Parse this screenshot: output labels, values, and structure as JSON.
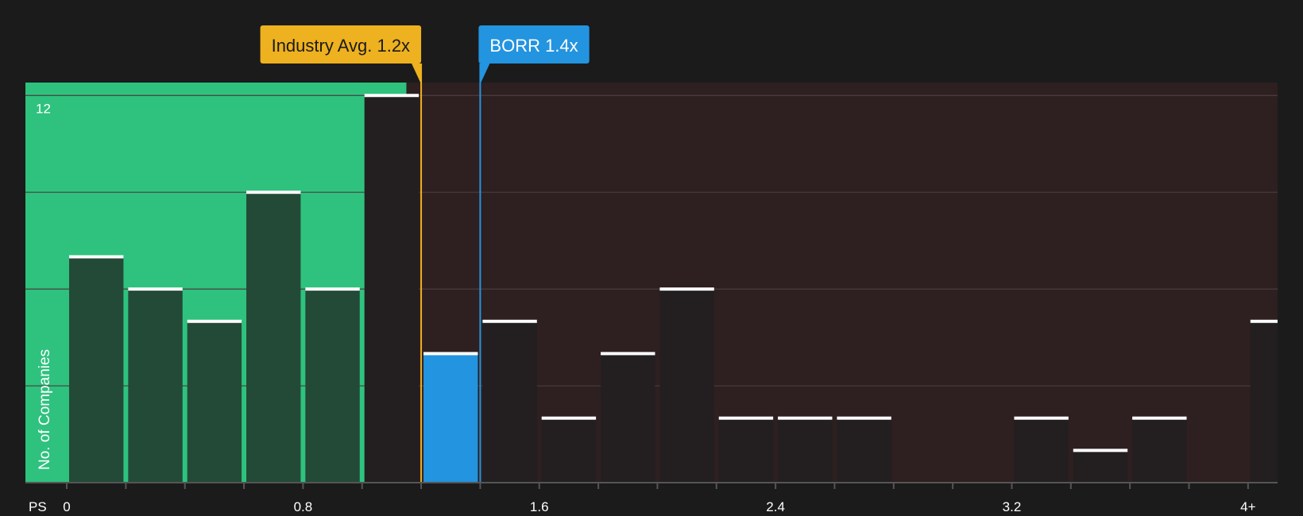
{
  "chart_data": {
    "type": "bar",
    "xlabel": "PS",
    "ylabel": "No. of Companies",
    "x_ticks": [
      "0",
      "0.8",
      "1.6",
      "2.4",
      "3.2",
      "4+"
    ],
    "x_tick_values": [
      0,
      0.8,
      1.6,
      2.4,
      3.2,
      4
    ],
    "y_ticks": [
      12
    ],
    "ylim": [
      0,
      12.4
    ],
    "xlim": [
      -0.14,
      4.1
    ],
    "bin_width": 0.2,
    "grid": true,
    "bins": [
      {
        "start": 0.0,
        "count": 7
      },
      {
        "start": 0.2,
        "count": 6
      },
      {
        "start": 0.4,
        "count": 5
      },
      {
        "start": 0.6,
        "count": 9
      },
      {
        "start": 0.8,
        "count": 6
      },
      {
        "start": 1.0,
        "count": 12
      },
      {
        "start": 1.2,
        "count": 4,
        "highlight": true
      },
      {
        "start": 1.4,
        "count": 5
      },
      {
        "start": 1.6,
        "count": 2
      },
      {
        "start": 1.8,
        "count": 4
      },
      {
        "start": 2.0,
        "count": 6
      },
      {
        "start": 2.2,
        "count": 2
      },
      {
        "start": 2.4,
        "count": 2
      },
      {
        "start": 2.6,
        "count": 2
      },
      {
        "start": 2.8,
        "count": 0
      },
      {
        "start": 3.0,
        "count": 0
      },
      {
        "start": 3.2,
        "count": 2
      },
      {
        "start": 3.4,
        "count": 1
      },
      {
        "start": 3.6,
        "count": 2
      },
      {
        "start": 3.8,
        "count": 0
      },
      {
        "start": 4.0,
        "count": 5
      }
    ],
    "undervalued_zone_end": 1.15,
    "markers": [
      {
        "label": "Industry Avg. 1.2x",
        "value": 1.2,
        "color": "#eeb11f",
        "text_color": "#1b1b1b"
      },
      {
        "label": "BORR 1.4x",
        "value": 1.4,
        "color": "#2394e0",
        "text_color": "#ffffff"
      }
    ],
    "colors": {
      "background": "#1b1b1b",
      "undervalued_zone": "#2ec27e",
      "overvalued_zone": "#2e1f20",
      "bar_in_undervalued": "#234a37",
      "bar_in_overvalued": "#231f20",
      "highlight_bar": "#2394e0",
      "bar_cap": "#ffffff",
      "gridline": "#4a3e3f",
      "axis": "#555555"
    }
  }
}
